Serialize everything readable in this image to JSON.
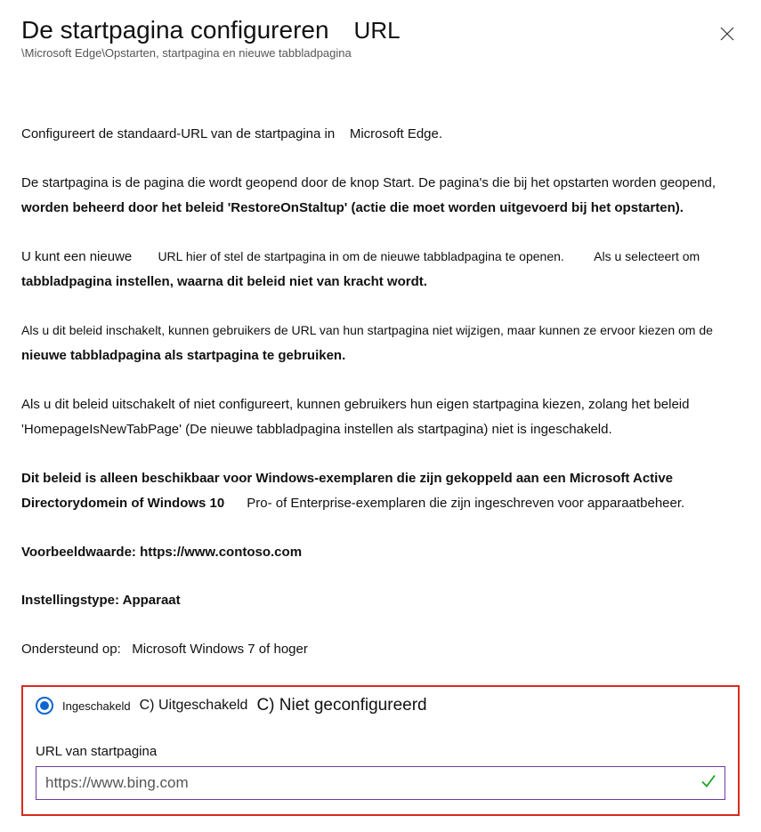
{
  "header": {
    "title": "De startpagina configureren",
    "title_suffix": "URL",
    "breadcrumb": "\\Microsoft Edge\\Opstarten, startpagina en nieuwe tabbladpagina"
  },
  "description": {
    "intro_a": "Configureert de standaard-URL van de startpagina in",
    "intro_b": "Microsoft Edge.",
    "p2a": "De startpagina is de pagina die wordt geopend door de knop Start. De pagina's die bij het opstarten worden geopend,",
    "p2b": "worden beheerd door het beleid 'RestoreOnStaltup' (actie die moet worden uitgevoerd bij het opstarten).",
    "p3a": "U kunt een nieuwe",
    "p3b": "URL hier of stel de startpagina in om de nieuwe tabbladpagina te openen.",
    "p3c": "Als u selecteert om",
    "p3d": "tabbladpagina instellen, waarna dit beleid niet van kracht wordt.",
    "p4a": "Als u dit beleid inschakelt, kunnen gebruikers de URL van hun startpagina niet wijzigen, maar kunnen ze ervoor kiezen om de",
    "p4b": "nieuwe tabbladpagina als startpagina te gebruiken.",
    "p5": "Als u dit beleid uitschakelt of niet configureert, kunnen gebruikers hun eigen startpagina kiezen, zolang het beleid 'HomepageIsNewTabPage' (De nieuwe tabbladpagina instellen als startpagina) niet is ingeschakeld.",
    "p6a": "Dit beleid is alleen beschikbaar voor Windows-exemplaren die zijn gekoppeld aan een Microsoft Active Directorydomein of Windows 10",
    "p6b": "Pro- of Enterprise-exemplaren die zijn ingeschreven voor apparaatbeheer."
  },
  "meta": {
    "example": "Voorbeeldwaarde: https://www.contoso.com",
    "setting_type": "Instellingstype: Apparaat",
    "supported_label": "Ondersteund op:",
    "supported_value": "Microsoft Windows 7 of hoger"
  },
  "options": {
    "enabled": "Ingeschakeld",
    "disabled": "C) Uitgeschakeld",
    "not_configured": "C) Niet geconfigureerd"
  },
  "form": {
    "url_label": "URL van startpagina",
    "url_value": "https://www.bing.com"
  }
}
